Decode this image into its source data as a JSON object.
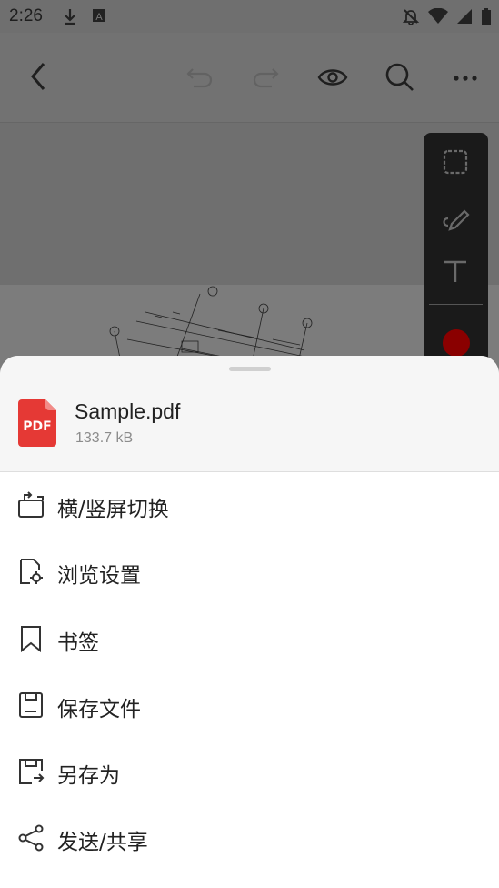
{
  "status_bar": {
    "time": "2:26",
    "icons": [
      "download-icon",
      "app-a-icon",
      "bell-off-icon",
      "wifi-icon",
      "signal-icon",
      "battery-icon"
    ]
  },
  "toolbar": {
    "icons": [
      "back-icon",
      "undo-icon",
      "redo-icon",
      "view-icon",
      "search-icon",
      "more-icon"
    ]
  },
  "side_panel": {
    "tools": [
      "lasso-icon",
      "pen-icon",
      "text-icon"
    ],
    "current_color": "#8a0000"
  },
  "file": {
    "icon_label": "PDF",
    "name": "Sample.pdf",
    "size": "133.7 kB"
  },
  "menu": [
    {
      "label": "横/竖屏切换",
      "icon": "rotate-screen-icon"
    },
    {
      "label": "浏览设置",
      "icon": "view-settings-icon"
    },
    {
      "label": "书签",
      "icon": "bookmark-icon"
    },
    {
      "label": "保存文件",
      "icon": "save-icon"
    },
    {
      "label": "另存为",
      "icon": "save-as-icon"
    },
    {
      "label": "发送/共享",
      "icon": "share-icon"
    }
  ],
  "colors": {
    "pdf_red": "#e53935",
    "accent_dark": "#1a1a1a"
  }
}
